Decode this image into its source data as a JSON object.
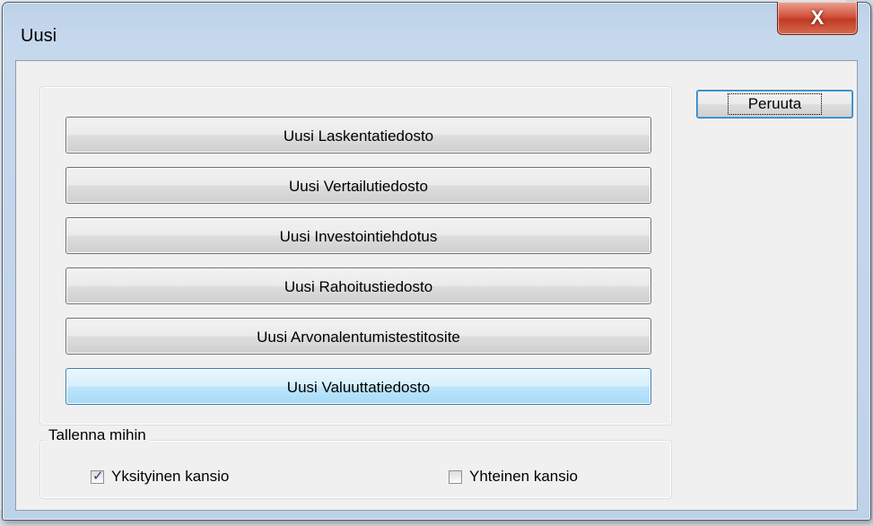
{
  "window": {
    "title": "Uusi",
    "close_symbol": "X"
  },
  "options": [
    {
      "label": "Uusi Laskentatiedosto",
      "focused": false
    },
    {
      "label": "Uusi Vertailutiedosto",
      "focused": false
    },
    {
      "label": "Uusi Investointiehdotus",
      "focused": false
    },
    {
      "label": "Uusi Rahoitustiedosto",
      "focused": false
    },
    {
      "label": "Uusi Arvonalentumistestitosite",
      "focused": false
    },
    {
      "label": "Uusi Valuuttatiedosto",
      "focused": true
    }
  ],
  "cancel_label": "Peruuta",
  "save_location": {
    "legend": "Tallenna mihin",
    "private_label": "Yksityinen kansio",
    "private_checked": true,
    "shared_label": "Yhteinen kansio",
    "shared_checked": false
  }
}
